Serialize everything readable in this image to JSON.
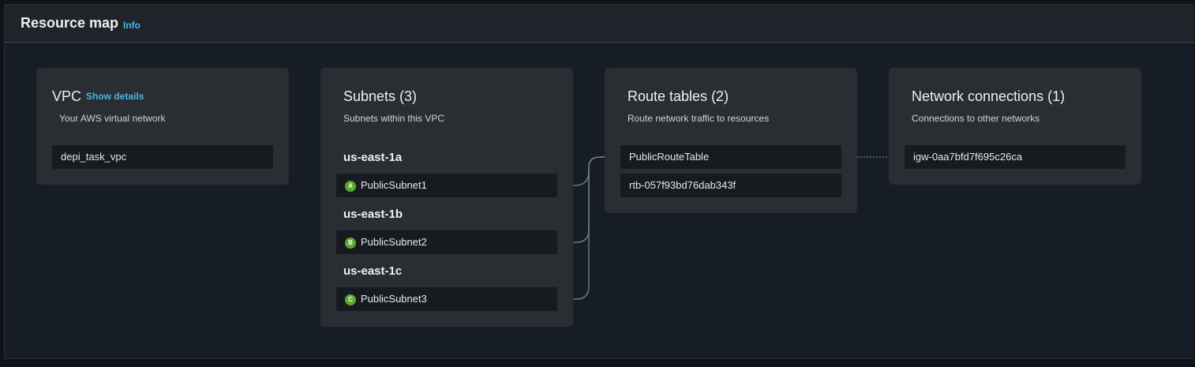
{
  "header": {
    "title": "Resource map",
    "info_label": "Info"
  },
  "vpc": {
    "title": "VPC",
    "show_details": "Show details",
    "subtitle": "Your AWS virtual network",
    "items": [
      "depi_task_vpc"
    ]
  },
  "subnets": {
    "title": "Subnets (3)",
    "subtitle": "Subnets within this VPC",
    "zones": [
      {
        "az": "us-east-1a",
        "badge": "A",
        "name": "PublicSubnet1"
      },
      {
        "az": "us-east-1b",
        "badge": "B",
        "name": "PublicSubnet2"
      },
      {
        "az": "us-east-1c",
        "badge": "C",
        "name": "PublicSubnet3"
      }
    ]
  },
  "route_tables": {
    "title": "Route tables (2)",
    "subtitle": "Route network traffic to resources",
    "items": [
      "PublicRouteTable",
      "rtb-057f93bd76dab343f"
    ]
  },
  "network_connections": {
    "title": "Network connections (1)",
    "subtitle": "Connections to other networks",
    "items": [
      "igw-0aa7bfd7f695c26ca"
    ]
  },
  "colors": {
    "link": "#4bb4e6",
    "badge": "#5ba82f",
    "connector": "#7d8590"
  }
}
